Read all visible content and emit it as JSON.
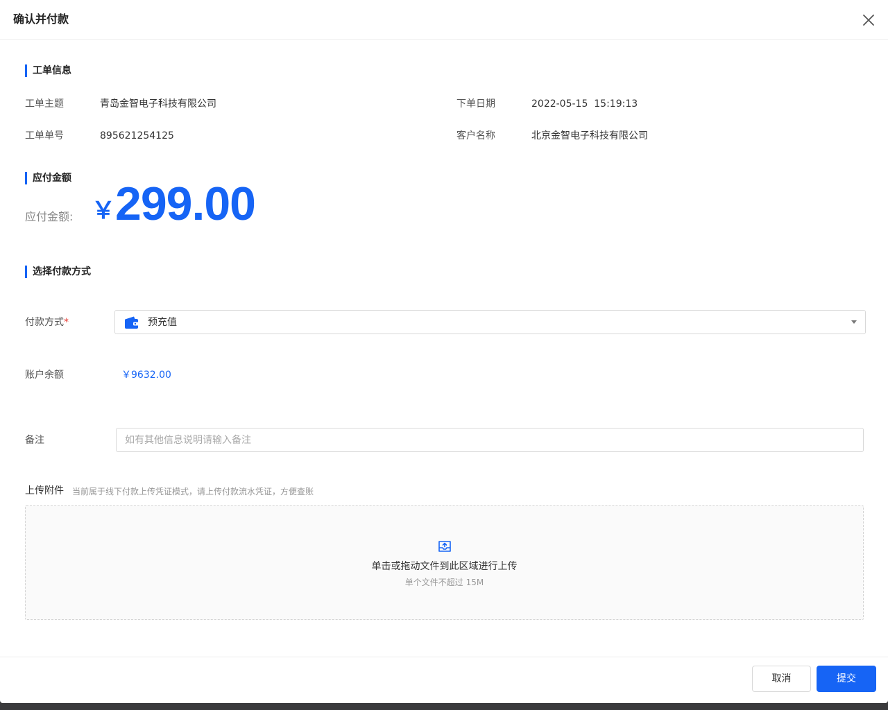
{
  "modal": {
    "title": "确认并付款"
  },
  "work_order": {
    "section_title": "工单信息",
    "subject_label": "工单主题",
    "subject_value": "青岛金智电子科技有限公司",
    "date_label": "下单日期",
    "date_value": "2022-05-15  15:19:13",
    "number_label": "工单单号",
    "number_value": "895621254125",
    "customer_label": "客户名称",
    "customer_value": "北京金智电子科技有限公司"
  },
  "amount": {
    "section_title": "应付金额",
    "label": "应付金额:",
    "currency": "￥",
    "value": "299.00"
  },
  "payment": {
    "section_title": "选择付款方式",
    "method_label": "付款方式",
    "required_mark": "*",
    "method_icon": "wallet-icon",
    "method_value": "预充值",
    "balance_label": "账户余额",
    "balance_value": "￥9632.00",
    "remark_label": "备注",
    "remark_placeholder": "如有其他信息说明请输入备注",
    "remark_value": ""
  },
  "upload": {
    "title": "上传附件",
    "hint": "当前属于线下付款上传凭证模式，请上传付款流水凭证，方便查账",
    "icon": "inbox-upload-icon",
    "main_text": "单击或拖动文件到此区域进行上传",
    "sub_text": "单个文件不超过 15M"
  },
  "footer": {
    "cancel_label": "取消",
    "submit_label": "提交"
  },
  "colors": {
    "accent": "#1664f5",
    "required": "#e8453c"
  }
}
